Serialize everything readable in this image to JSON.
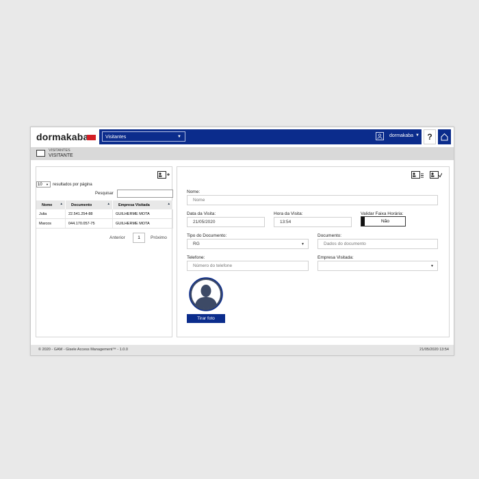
{
  "header": {
    "logo_text": "dormakaba",
    "module_select": "Visitantes",
    "user_name": "dormakaba",
    "help_label": "?"
  },
  "breadcrumb": {
    "parent": "VISITANTES",
    "current": "VISITANTE"
  },
  "list": {
    "page_length": "10",
    "page_length_label": "resultados por página",
    "search_label": "Pesquisar",
    "search_value": "",
    "columns": [
      "Nome",
      "Documento",
      "Empresa Visitada"
    ],
    "rows": [
      [
        "Julia",
        "22.541.254-88",
        "GUILHERME MOTA"
      ],
      [
        "Marcos",
        "044.170.057-75",
        "GUILHERME MOTA"
      ]
    ],
    "pager": {
      "prev": "Anterior",
      "page": "1",
      "next": "Próximo"
    }
  },
  "form": {
    "nome": {
      "label": "Nome:",
      "placeholder": "Nome"
    },
    "data_visita": {
      "label": "Data da Visita:",
      "value": "21/05/2020"
    },
    "hora_visita": {
      "label": "Hora da Visita:",
      "value": "13:54"
    },
    "validar": {
      "label": "Validar Faixa Horária:",
      "value": "Não"
    },
    "tipo_documento": {
      "label": "Tipo do Documento:",
      "value": "RG"
    },
    "documento": {
      "label": "Documento:",
      "placeholder": "Dados do documento"
    },
    "telefone": {
      "label": "Telefone:",
      "placeholder": "Número do telefone"
    },
    "empresa": {
      "label": "Empresa Visitada:",
      "value": ""
    },
    "photo_button": "Tirar foto"
  },
  "footer": {
    "copyright": "© 2020 - GAM - Gisele Access Management™ - 1.0.0",
    "timestamp": "21/05/2020 13:54"
  },
  "colors": {
    "brand_blue": "#0b2c8c",
    "logo_red": "#d31f26"
  }
}
